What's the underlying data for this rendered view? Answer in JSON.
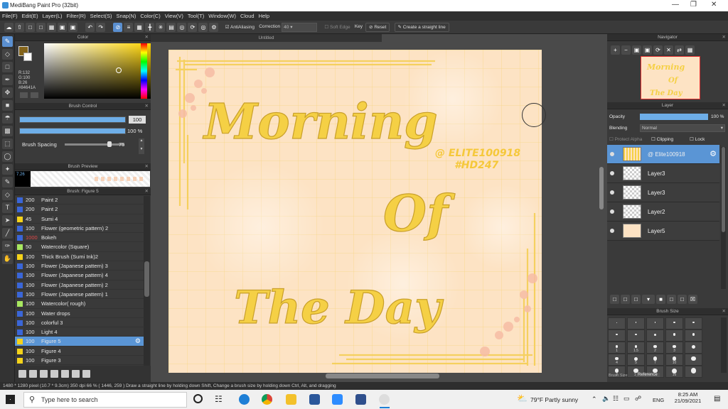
{
  "app": {
    "title": "MediBang Paint Pro (32bit)"
  },
  "menu": [
    "File(F)",
    "Edit(E)",
    "Layer(L)",
    "Filter(R)",
    "Select(S)",
    "Snap(N)",
    "Color(C)",
    "View(V)",
    "Tool(T)",
    "Window(W)",
    "Cloud",
    "Help"
  ],
  "toolbar": {
    "antialiasing": "AntiAliasing",
    "correction_label": "Correction",
    "correction_value": "40",
    "soft_edge": "Soft Edge",
    "key": "Key",
    "reset": "Reset",
    "straight_line": "Create a straight line"
  },
  "color_panel": {
    "title": "Color",
    "r": "R:132",
    "g": "G:100",
    "b": "B:26",
    "hex": "#84641A",
    "main_color": "#84641A"
  },
  "brush_control": {
    "title": "Brush Control",
    "size": "100",
    "opacity": "100 %",
    "spacing_label": "Brush Spacing",
    "spacing_value": "75",
    "size_fill": 1.0,
    "opacity_fill": 1.0,
    "spacing_fill": 0.75
  },
  "brush_preview": {
    "title": "Brush Preview",
    "size": "7.26"
  },
  "brush_list": {
    "title": "Brush: Figure 5",
    "items": [
      {
        "size": "200",
        "name": "Paint 2",
        "color": "#3a66d8"
      },
      {
        "size": "200",
        "name": "Paint 2",
        "color": "#3a66d8"
      },
      {
        "size": "45",
        "name": "Sumi 4",
        "color": "#f5d31a"
      },
      {
        "size": "100",
        "name": "Flower (geometric pattern) 2",
        "color": "#3a66d8"
      },
      {
        "size": "1000",
        "name": "Bokeh",
        "color": "#3a66d8",
        "size_color": "#e04848"
      },
      {
        "size": "50",
        "name": "Watercolor (Square)",
        "color": "#a8e860"
      },
      {
        "size": "100",
        "name": "Thick Brush (Sumi Ink)2",
        "color": "#f5d31a"
      },
      {
        "size": "100",
        "name": "Flower (Japanese pattern) 3",
        "color": "#3a66d8"
      },
      {
        "size": "100",
        "name": "Flower (Japanese pattern) 4",
        "color": "#3a66d8"
      },
      {
        "size": "100",
        "name": "Flower (Japanese pattern) 2",
        "color": "#3a66d8"
      },
      {
        "size": "100",
        "name": "Flower (Japanese pattern) 1",
        "color": "#3a66d8"
      },
      {
        "size": "100",
        "name": "Watercolor( rough)",
        "color": "#a8e860"
      },
      {
        "size": "100",
        "name": "Water drops",
        "color": "#3a66d8"
      },
      {
        "size": "100",
        "name": "colorful 3",
        "color": "#3a66d8"
      },
      {
        "size": "100",
        "name": "Light 4",
        "color": "#3a66d8"
      },
      {
        "size": "100",
        "name": "Figure 5",
        "color": "#f5d31a",
        "selected": true
      },
      {
        "size": "100",
        "name": "Figure 4",
        "color": "#f5d31a"
      },
      {
        "size": "100",
        "name": "Figure 3",
        "color": "#f5d31a"
      }
    ]
  },
  "document": {
    "tab": "Untitled"
  },
  "artwork": {
    "line1": "Morning",
    "line2": "Of",
    "line3": "The Day",
    "credit1": "@ ELITE100918",
    "credit2": "#HD247",
    "text_color": "#f5d045",
    "bg_color": "#fde3c4"
  },
  "navigator": {
    "title": "Navigator"
  },
  "layer_panel": {
    "title": "Layer",
    "opacity_label": "Opacity",
    "opacity_value": "100 %",
    "blending_label": "Blending",
    "blending_value": "Normal",
    "protect_alpha": "Protect Alpha",
    "clipping": "Clipping",
    "lock": "Lock",
    "layers": [
      {
        "name": "@ Elite100918",
        "selected": true
      },
      {
        "name": "Layer3"
      },
      {
        "name": "Layer3"
      },
      {
        "name": "Layer2"
      },
      {
        "name": "Layer5"
      }
    ]
  },
  "brush_size": {
    "title": "Brush Size",
    "values": [
      "",
      "",
      "",
      "",
      "",
      "",
      "",
      "",
      "",
      "",
      "1",
      "1.5",
      "2",
      "3",
      "",
      "4",
      "5",
      "7",
      "10",
      "",
      "7",
      "10",
      "12",
      "16",
      ""
    ],
    "tab1": "Brush Size",
    "tab2": "Reference"
  },
  "status": {
    "text": "1480 * 1280 pixel  (10.7 * 9.3cm)  350 dpi  66 %  ( 1446, 259 )  Draw a straight line by holding down Shift, Change a brush size by holding down Ctrl, Alt, and dragging"
  },
  "taskbar": {
    "search_placeholder": "Type here to search",
    "weather": "79°F  Partly sunny",
    "lang": "ENG",
    "time": "8:25 AM",
    "date": "21/09/2021"
  }
}
